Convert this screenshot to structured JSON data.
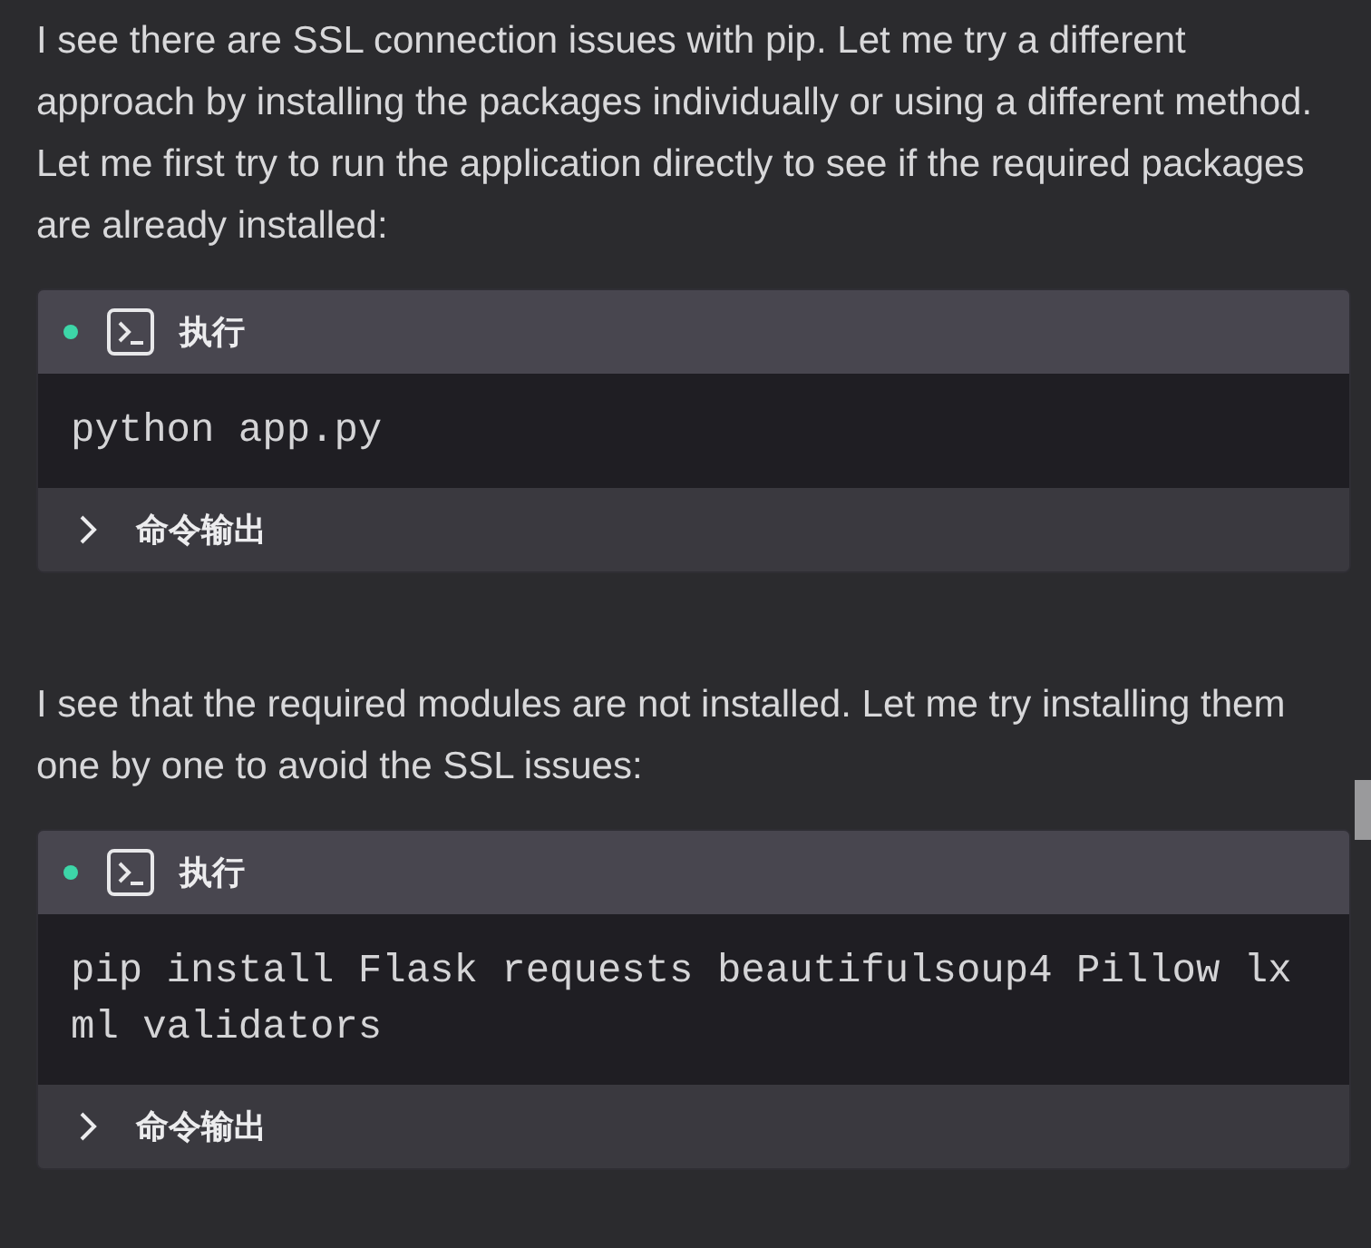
{
  "messages": [
    {
      "text": "I see there are SSL connection issues with pip. Let me try a different approach by installing the packages individually or using a different method. Let me first try to run the application directly to see if the required packages are already installed:",
      "tool": {
        "title": "执行",
        "command": "python app.py",
        "output": {
          "label": "命令输出",
          "expanded": false
        }
      }
    },
    {
      "text": "I see that the required modules are not installed. Let me try installing them one by one to avoid the SSL issues:",
      "tool": {
        "title": "执行",
        "command": "pip install Flask requests beautifulsoup4 Pillow lxml validators",
        "output": {
          "label": "命令输出",
          "expanded": false
        }
      }
    }
  ]
}
